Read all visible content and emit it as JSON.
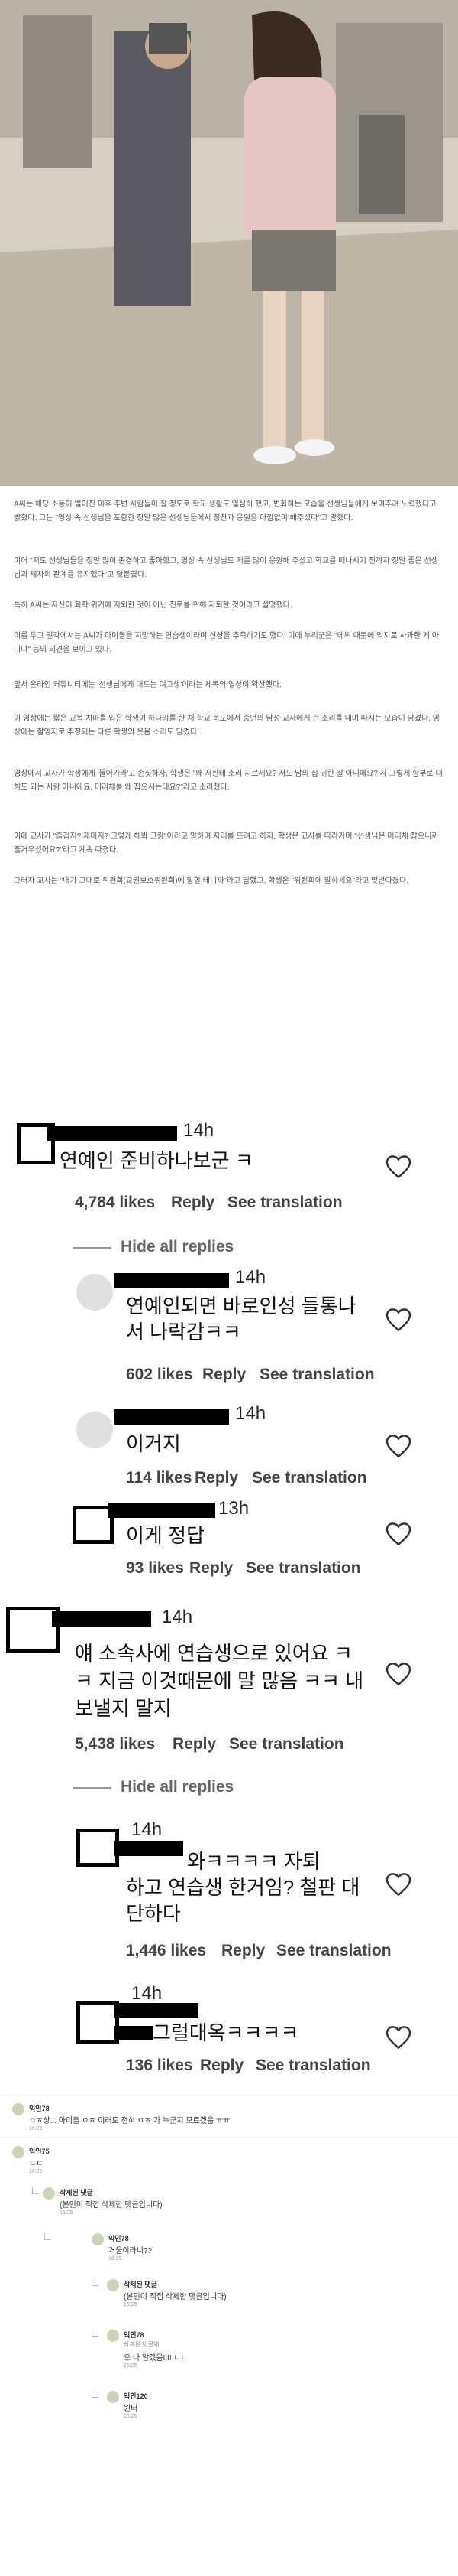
{
  "article": {
    "paragraphs": [
      "A씨는 해당 소동이 벌어진 이후 주변 사람들이 잘 정도로 학교 생활도 열심히 했고, 변화하는 모습을 선생님들에게 보여주려 노력했다고 밝혔다. 그는 \"영상 속 선생님을 포함한 정말 많은 선생님들에서 칭찬과 응원을 아낌없이 해주셨다\"고 말했다.",
      "이어 \"저도 선생님들을 정말 많이 존경하고 좋아했고, 영상 속 선생님도 저를 많이 응원해 주셨고 학교를 떠나시기 전까지 정말 좋은 선생님과 제자의 관계를 유지했다\"고 덧붙였다.",
      "특히 A씨는 자신이 회학 위기에 자퇴한 것이 아닌 진로를 위해 자퇴한 것이라고 설명했다.",
      "이를 두고 일각에서는 A씨가 아이돌을 지망하는 연습생이라며 신상을 추측하기도 했다. 이에 누리꾼은 \"데뷔 때문에 억지로 사과한 게 아니냐\" 등의 의견을 보이고 있다.",
      "앞서 온라인 커뮤니티에는 '선생님에게 대드는 여고생'이라는 제목의 영상이 확산했다.",
      "이 영상에는 짧은 교복 치마를 입은 학생이 하다리를 한 채 학교 복도에서 중년의 남성 교사에게 큰 소리를 내며 따지는 모습이 담겼다. 영상에는 촬영자로 추정되는 다른 학생의 웃음 소리도 담겼다.",
      "영상에서 교사가 학생에게 '들어가라'고 손짓하자, 학생은 \"왜 저한테 소리 지르세요? 저도 남의 집 귀한 딸 아니에요? 저 그렇게 함부로 대해도 되는 사람 아니에요. 머리채를 왜 잡으시는데요?\"라고 소리쳤다.",
      "이에 교사가 \"즐겁지? 재미지? 그렇게 해봐 그랑\"이라고 말하며 자리를 뜨려고 하자, 학생은 교사를 따라가며 \"선생님은 머리채 잡으니까 즐거우셨어요?\"라고 계속 따졌다.",
      "그러자 교사는 \"내가 그대로 위원회(교권보호위원회)에 말할 테니까\"라고 답했고, 학생은 \"위원회에 말하세요\"라고 맞받아쳤다."
    ]
  },
  "comments": {
    "c1": {
      "time": "14h",
      "text": "연예인 준비하나보군 ㅋ",
      "likes": "4,784 likes",
      "reply": "Reply",
      "see_translation": "See translation"
    },
    "hide1": "Hide all replies",
    "r1": {
      "time": "14h",
      "text1": "연예인되면 바로인성 들통나",
      "text2": "서 나락감ㅋㅋ",
      "likes": "602 likes",
      "reply": "Reply",
      "see_translation": "See translation"
    },
    "r2": {
      "time": "14h",
      "text": "이거지",
      "likes": "114 likes",
      "reply": "Reply",
      "see_translation": "See translation"
    },
    "r3": {
      "time": "13h",
      "text": "이게 정답",
      "likes": "93 likes",
      "reply": "Reply",
      "see_translation": "See translation"
    },
    "c2": {
      "time": "14h",
      "text1": "얘 소속사에 연습생으로 있어요 ㅋ",
      "text2": "ㅋ 지금 이것때문에 말 많음 ㅋㅋ 내",
      "text3": "보낼지 말지",
      "likes": "5,438 likes",
      "reply": "Reply",
      "see_translation": "See translation"
    },
    "hide2": "Hide all replies",
    "r4": {
      "time": "14h",
      "text1": "와ㅋㅋㅋㅋ 자퇴",
      "text2": "하고 연습생 한거임? 철판 대",
      "text3": "단하다",
      "likes": "1,446 likes",
      "reply": "Reply",
      "see_translation": "See translation"
    },
    "r5": {
      "time": "14h",
      "text": "그럴대옥ㅋㅋㅋㅋ",
      "likes": "136 likes",
      "reply": "Reply",
      "see_translation": "See translation"
    }
  },
  "cafe": {
    "items": [
      {
        "name": "익인78",
        "text": "ㅇㅎ상... 아이돌 ㅇㅎ 이러도 전혀 ㅇㅎ 가 누군지 모르겠음 ㅠㅠ",
        "time": "16:25"
      },
      {
        "name": "익인75",
        "text": "ㄴㄷ",
        "time": "16:25"
      },
      {
        "name": "삭제된 댓글",
        "text": "(본인이 직접 삭제한 댓글입니다)",
        "time": "16:25"
      },
      {
        "name": "익인78",
        "text": "거울이라니??",
        "time": "16:25"
      },
      {
        "name": "삭제된 댓글",
        "text": "(본인이 직접 삭제한 댓글입니다)",
        "time": "16:25"
      },
      {
        "name": "익인78",
        "text1": "삭제된 댓글에",
        "text2": "오 나 알겠음!!!! ㄴㄴ",
        "time": "16:25"
      },
      {
        "name": "익인120",
        "text": "윈터",
        "time": "16:25"
      }
    ]
  }
}
